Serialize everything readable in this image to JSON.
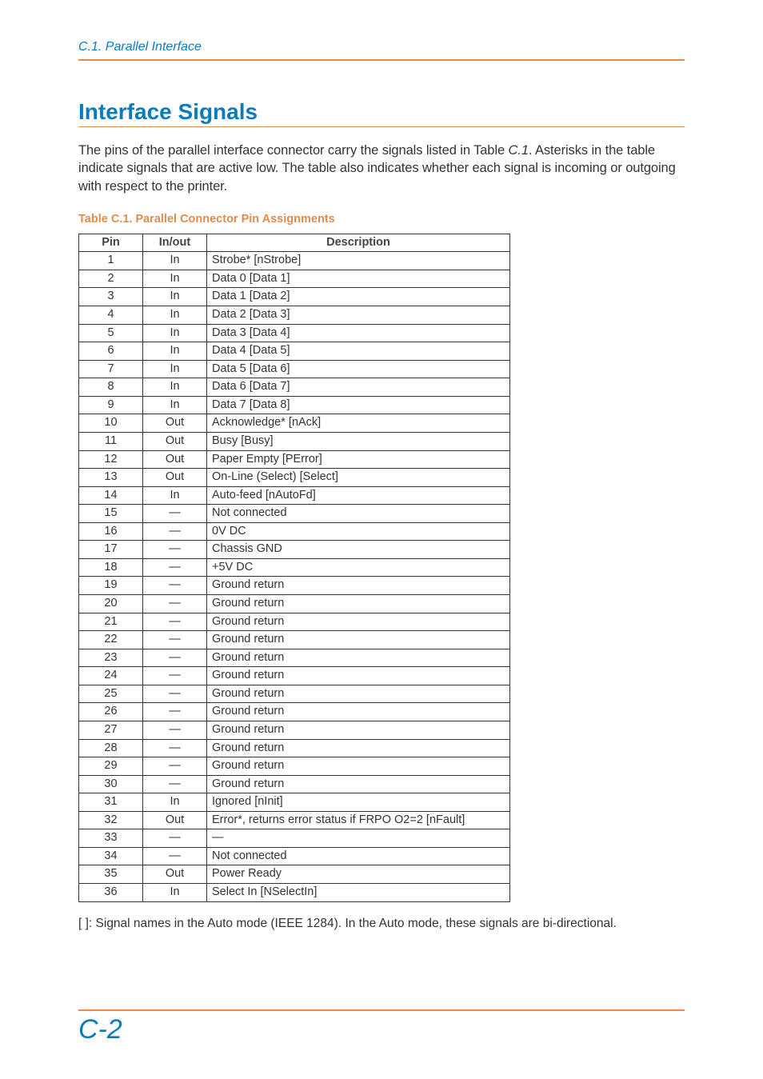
{
  "header": {
    "running": "C.1.  Parallel Interface"
  },
  "section": {
    "title": "Interface Signals",
    "intro_pre": "The pins of the parallel interface connector carry the signals listed in Table ",
    "intro_ref": "C.1",
    "intro_post": ". Asterisks in the table indicate signals that are active low. The table also indicates whether each signal is incoming or outgoing with respect to the printer."
  },
  "table": {
    "caption": "Table C.1.  Parallel Connector Pin Assignments",
    "headers": {
      "pin": "Pin",
      "io": "In/out",
      "desc": "Description"
    },
    "rows": [
      {
        "pin": "1",
        "io": "In",
        "desc": "Strobe* [nStrobe]"
      },
      {
        "pin": "2",
        "io": "In",
        "desc": "Data 0 [Data 1]"
      },
      {
        "pin": "3",
        "io": "In",
        "desc": "Data 1 [Data 2]"
      },
      {
        "pin": "4",
        "io": "In",
        "desc": "Data 2 [Data 3]"
      },
      {
        "pin": "5",
        "io": "In",
        "desc": "Data 3 [Data 4]"
      },
      {
        "pin": "6",
        "io": "In",
        "desc": "Data 4 [Data 5]"
      },
      {
        "pin": "7",
        "io": "In",
        "desc": "Data 5 [Data 6]"
      },
      {
        "pin": "8",
        "io": "In",
        "desc": "Data 6 [Data 7]"
      },
      {
        "pin": "9",
        "io": "In",
        "desc": "Data 7 [Data 8]"
      },
      {
        "pin": "10",
        "io": "Out",
        "desc": "Acknowledge* [nAck]"
      },
      {
        "pin": "11",
        "io": "Out",
        "desc": "Busy [Busy]"
      },
      {
        "pin": "12",
        "io": "Out",
        "desc": "Paper Empty [PError]"
      },
      {
        "pin": "13",
        "io": "Out",
        "desc": "On-Line (Select) [Select]"
      },
      {
        "pin": "14",
        "io": "In",
        "desc": "Auto-feed [nAutoFd]"
      },
      {
        "pin": "15",
        "io": "—",
        "desc": "Not connected"
      },
      {
        "pin": "16",
        "io": "—",
        "desc": "0V DC"
      },
      {
        "pin": "17",
        "io": "—",
        "desc": "Chassis GND"
      },
      {
        "pin": "18",
        "io": "—",
        "desc": "+5V DC"
      },
      {
        "pin": "19",
        "io": "—",
        "desc": "Ground return"
      },
      {
        "pin": "20",
        "io": "—",
        "desc": "Ground return"
      },
      {
        "pin": "21",
        "io": "—",
        "desc": "Ground return"
      },
      {
        "pin": "22",
        "io": "—",
        "desc": "Ground return"
      },
      {
        "pin": "23",
        "io": "—",
        "desc": "Ground return"
      },
      {
        "pin": "24",
        "io": "—",
        "desc": "Ground return"
      },
      {
        "pin": "25",
        "io": "—",
        "desc": "Ground return"
      },
      {
        "pin": "26",
        "io": "—",
        "desc": "Ground return"
      },
      {
        "pin": "27",
        "io": "—",
        "desc": "Ground return"
      },
      {
        "pin": "28",
        "io": "—",
        "desc": "Ground return"
      },
      {
        "pin": "29",
        "io": "—",
        "desc": "Ground return"
      },
      {
        "pin": "30",
        "io": "—",
        "desc": "Ground return"
      },
      {
        "pin": "31",
        "io": "In",
        "desc": "Ignored [nInit]"
      },
      {
        "pin": "32",
        "io": "Out",
        "desc": "Error*, returns error status if FRPO O2=2 [nFault]"
      },
      {
        "pin": "33",
        "io": "—",
        "desc": "—"
      },
      {
        "pin": "34",
        "io": "—",
        "desc": "Not connected"
      },
      {
        "pin": "35",
        "io": "Out",
        "desc": "Power Ready"
      },
      {
        "pin": "36",
        "io": "In",
        "desc": "Select In [NSelectIn]"
      }
    ]
  },
  "footnote": "[    ]: Signal names in the Auto mode (IEEE 1284).  In the Auto mode, these signals are bi-directional.",
  "footer": {
    "page": "C-2"
  }
}
